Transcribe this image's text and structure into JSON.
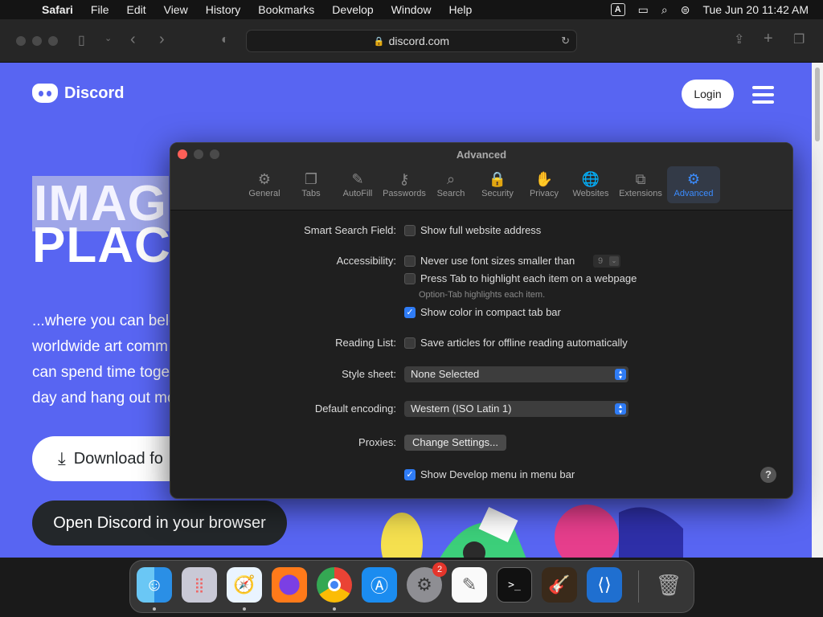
{
  "menubar": {
    "app": "Safari",
    "items": [
      "File",
      "Edit",
      "View",
      "History",
      "Bookmarks",
      "Develop",
      "Window",
      "Help"
    ],
    "keyboard_badge": "A",
    "clock": "Tue Jun 20  11:42 AM"
  },
  "browser": {
    "url": "discord.com"
  },
  "page": {
    "logo_text": "Discord",
    "login_label": "Login",
    "hero_line1": "IMAG",
    "hero_line2": "PLAC",
    "tagline_lines": [
      "...where you can belo",
      "worldwide art comm",
      "can spend time toge",
      "day and hang out mo"
    ],
    "download_label": "Download fo",
    "open_browser_label": "Open Discord in your browser"
  },
  "prefs": {
    "title": "Advanced",
    "tabs": [
      {
        "label": "General",
        "icon": "gear-icon",
        "glyph": "⚙"
      },
      {
        "label": "Tabs",
        "icon": "tabs-icon",
        "glyph": "❐"
      },
      {
        "label": "AutoFill",
        "icon": "autofill-icon",
        "glyph": "✎"
      },
      {
        "label": "Passwords",
        "icon": "key-icon",
        "glyph": "⚷"
      },
      {
        "label": "Search",
        "icon": "search-icon",
        "glyph": "⌕"
      },
      {
        "label": "Security",
        "icon": "lock-icon",
        "glyph": "🔒"
      },
      {
        "label": "Privacy",
        "icon": "hand-icon",
        "glyph": "✋"
      },
      {
        "label": "Websites",
        "icon": "globe-icon",
        "glyph": "🌐"
      },
      {
        "label": "Extensions",
        "icon": "puzzle-icon",
        "glyph": "⧉"
      },
      {
        "label": "Advanced",
        "icon": "advanced-gears-icon",
        "glyph": "⚙"
      }
    ],
    "active_tab": "Advanced",
    "smart_search_label": "Smart Search Field:",
    "show_full_address": "Show full website address",
    "accessibility_label": "Accessibility:",
    "never_font_sizes": "Never use font sizes smaller than",
    "font_size_value": "9",
    "press_tab": "Press Tab to highlight each item on a webpage",
    "option_tab_hint": "Option-Tab highlights each item.",
    "show_color_tab_bar": "Show color in compact tab bar",
    "reading_list_label": "Reading List:",
    "save_offline": "Save articles for offline reading automatically",
    "style_sheet_label": "Style sheet:",
    "style_sheet_value": "None Selected",
    "encoding_label": "Default encoding:",
    "encoding_value": "Western (ISO Latin 1)",
    "proxies_label": "Proxies:",
    "proxies_button": "Change Settings...",
    "develop_menu": "Show Develop menu in menu bar",
    "help": "?"
  },
  "dock": {
    "apps": [
      "Finder",
      "Launchpad",
      "Safari",
      "Firefox",
      "Chrome",
      "App Store",
      "System Settings",
      "TextEdit",
      "Terminal",
      "GarageBand",
      "Visual Studio Code"
    ],
    "settings_badge": "2"
  }
}
